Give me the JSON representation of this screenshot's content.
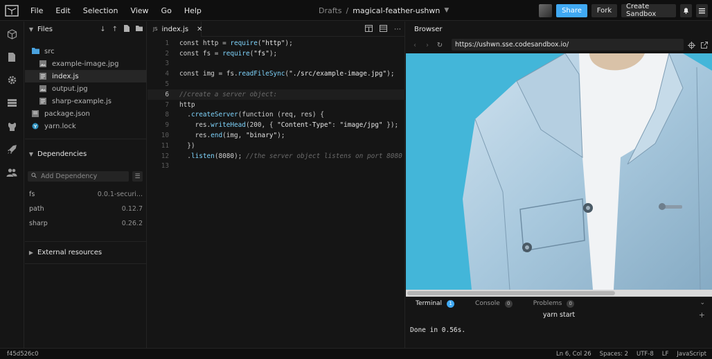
{
  "menu": [
    "File",
    "Edit",
    "Selection",
    "View",
    "Go",
    "Help"
  ],
  "breadcrumb": {
    "folder": "Drafts",
    "separator": "/",
    "name": "magical-feather-ushwn"
  },
  "toolbar": {
    "share": "Share",
    "fork": "Fork",
    "create": "Create Sandbox"
  },
  "sidebar": {
    "files_title": "Files",
    "tree": [
      {
        "label": "src",
        "type": "folder"
      },
      {
        "label": "example-image.jpg",
        "type": "image"
      },
      {
        "label": "index.js",
        "type": "js",
        "active": true
      },
      {
        "label": "output.jpg",
        "type": "image"
      },
      {
        "label": "sharp-example.js",
        "type": "js"
      },
      {
        "label": "package.json",
        "type": "json"
      },
      {
        "label": "yarn.lock",
        "type": "yarn"
      }
    ],
    "dependencies_title": "Dependencies",
    "add_dependency_placeholder": "Add Dependency",
    "dependencies": [
      {
        "name": "fs",
        "version": "0.0.1-securi..."
      },
      {
        "name": "path",
        "version": "0.12.7"
      },
      {
        "name": "sharp",
        "version": "0.26.2"
      }
    ],
    "external_title": "External resources"
  },
  "editor": {
    "tab_prefix": "JS",
    "tab_label": "index.js",
    "current_line": 6,
    "line_numbers": [
      "1",
      "2",
      "3",
      "4",
      "5",
      "6",
      "7",
      "8",
      "9",
      "10",
      "11",
      "12",
      "13"
    ]
  },
  "browser": {
    "title": "Browser",
    "url": "https://ushwn.sse.codesandbox.io/"
  },
  "terminal": {
    "tabs": [
      {
        "label": "Terminal",
        "badge": "1"
      },
      {
        "label": "Console",
        "badge": "0"
      },
      {
        "label": "Problems",
        "badge": "0"
      }
    ],
    "title": "yarn start",
    "output": "Done in 0.56s."
  },
  "status": {
    "commit": "f45d526c0",
    "position": "Ln 6, Col 26",
    "spaces": "Spaces: 2",
    "encoding": "UTF-8",
    "eol": "LF",
    "language": "JavaScript"
  },
  "colors": {
    "accent": "#40a9f3",
    "background": "#151515",
    "preview_bg": "#43b6d9"
  },
  "icons": [
    "codesandbox-logo-icon",
    "cube-icon",
    "file-icon",
    "gear-icon",
    "server-icon",
    "github-icon",
    "rocket-icon",
    "users-icon",
    "chevron-down-icon",
    "bell-icon",
    "menu-icon"
  ]
}
